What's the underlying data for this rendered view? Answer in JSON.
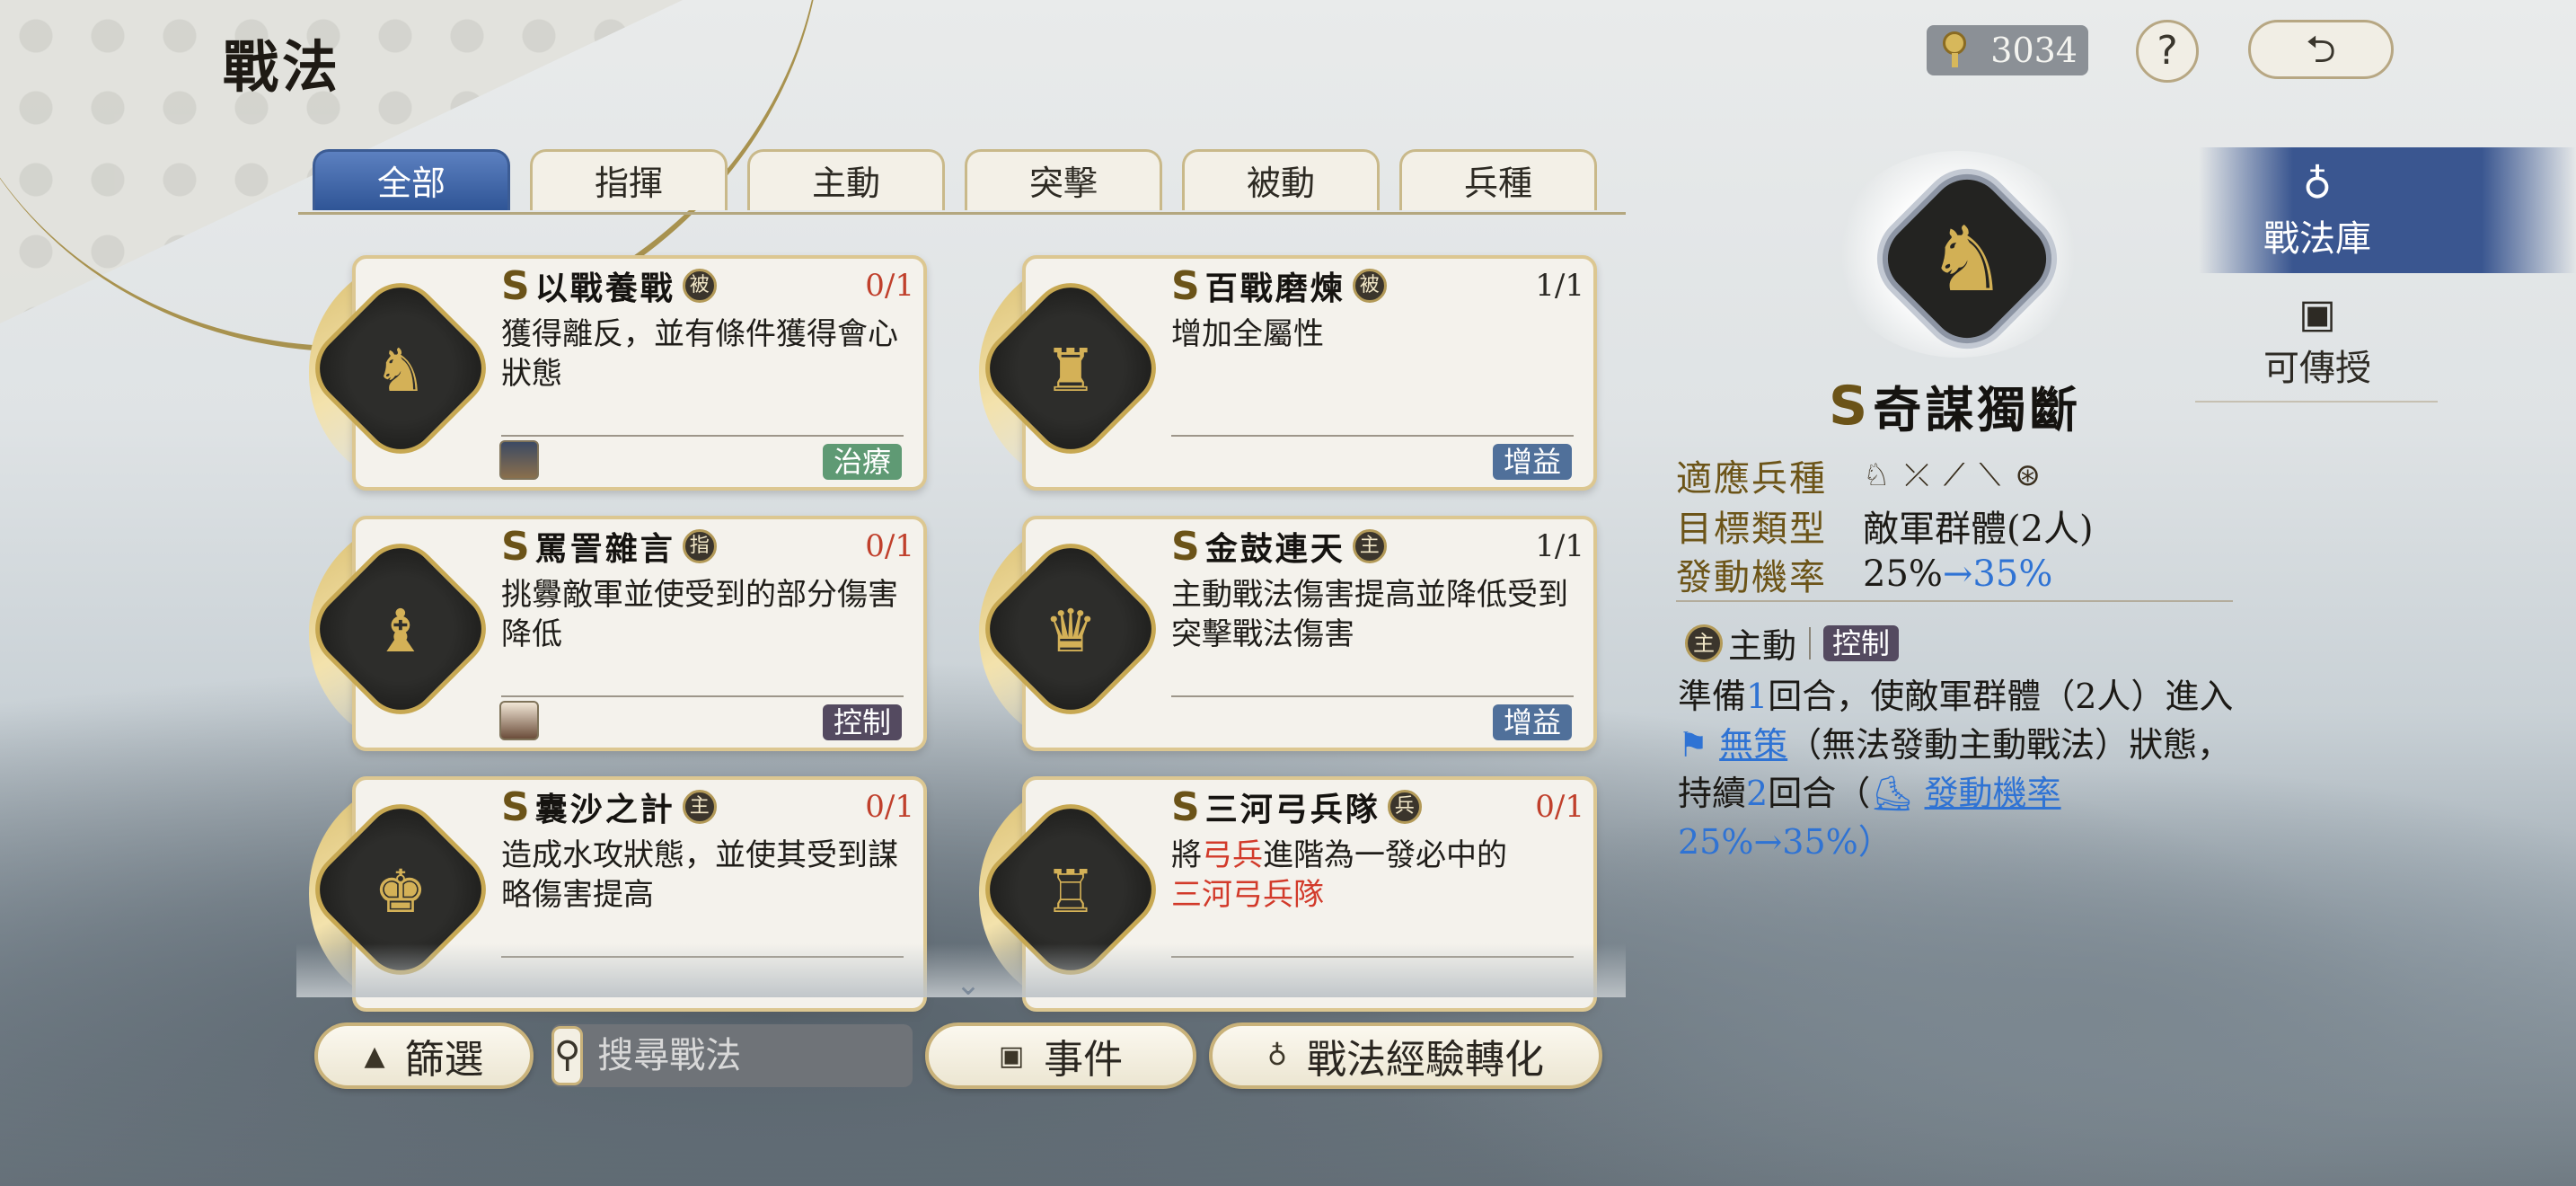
{
  "page": {
    "title": "戰法"
  },
  "top_bar": {
    "currency_value": "3034",
    "help_icon": "?",
    "back_icon": "⮌"
  },
  "tabs": [
    {
      "label": "全部",
      "active": true
    },
    {
      "label": "指揮",
      "active": false
    },
    {
      "label": "主動",
      "active": false
    },
    {
      "label": "突擊",
      "active": false
    },
    {
      "label": "被動",
      "active": false
    },
    {
      "label": "兵種",
      "active": false
    }
  ],
  "cards": [
    {
      "grade": "S",
      "name": "以戰養戰",
      "type": "被",
      "count": "0/1",
      "desc": "獲得離反，並有條件獲得會心狀態",
      "tag": "治療"
    },
    {
      "grade": "S",
      "name": "百戰磨煉",
      "type": "被",
      "count": "1/1",
      "desc": "增加全屬性",
      "tag": "增益"
    },
    {
      "grade": "S",
      "name": "罵詈雜言",
      "type": "指",
      "count": "0/1",
      "desc": "挑釁敵軍並使受到的部分傷害降低",
      "tag": "控制"
    },
    {
      "grade": "S",
      "name": "金鼓連天",
      "type": "主",
      "count": "1/1",
      "desc": "主動戰法傷害提高並降低受到突擊戰法傷害",
      "tag": "增益"
    },
    {
      "grade": "S",
      "name": "囊沙之計",
      "type": "主",
      "count": "0/1",
      "desc": "造成水攻狀態，並使其受到謀略傷害提高"
    },
    {
      "grade": "S",
      "name": "三河弓兵隊",
      "type": "兵",
      "count": "0/1",
      "desc_a": "將",
      "desc_b": "弓兵",
      "desc_c": "進階為一發必中的",
      "desc_d": "三河弓兵隊"
    }
  ],
  "bottom": {
    "filter_label": "篩選",
    "search_placeholder": "搜尋戰法",
    "event_label": "事件",
    "convert_label": "戰法經驗轉化"
  },
  "detail": {
    "grade": "S",
    "name": "奇謀獨斷",
    "troop_label": "適應兵種",
    "target_label": "目標類型",
    "target_value": "敵軍群體(2人)",
    "rate_label": "發動機率",
    "rate_from": "25%",
    "rate_to": "→35%",
    "type_badge": "主",
    "type_label": "主動",
    "effect_tag": "控制",
    "desc": {
      "p1": "準備",
      "n1": "1",
      "p2": "回合，使敵軍群體（2人）進入",
      "link1": "無策",
      "p3": "（無法發動主動戰法）狀態，持續",
      "n2": "2",
      "p4": "回合（",
      "link2": "發動機率",
      "n3": "25%→35%",
      "p5": "）"
    }
  },
  "side_nav": {
    "active_label": "戰法庫",
    "inactive_label": "可傳授"
  },
  "colors": {
    "accent_blue": "#2f73d4",
    "red": "#c0402c",
    "gold": "#c7a852"
  }
}
